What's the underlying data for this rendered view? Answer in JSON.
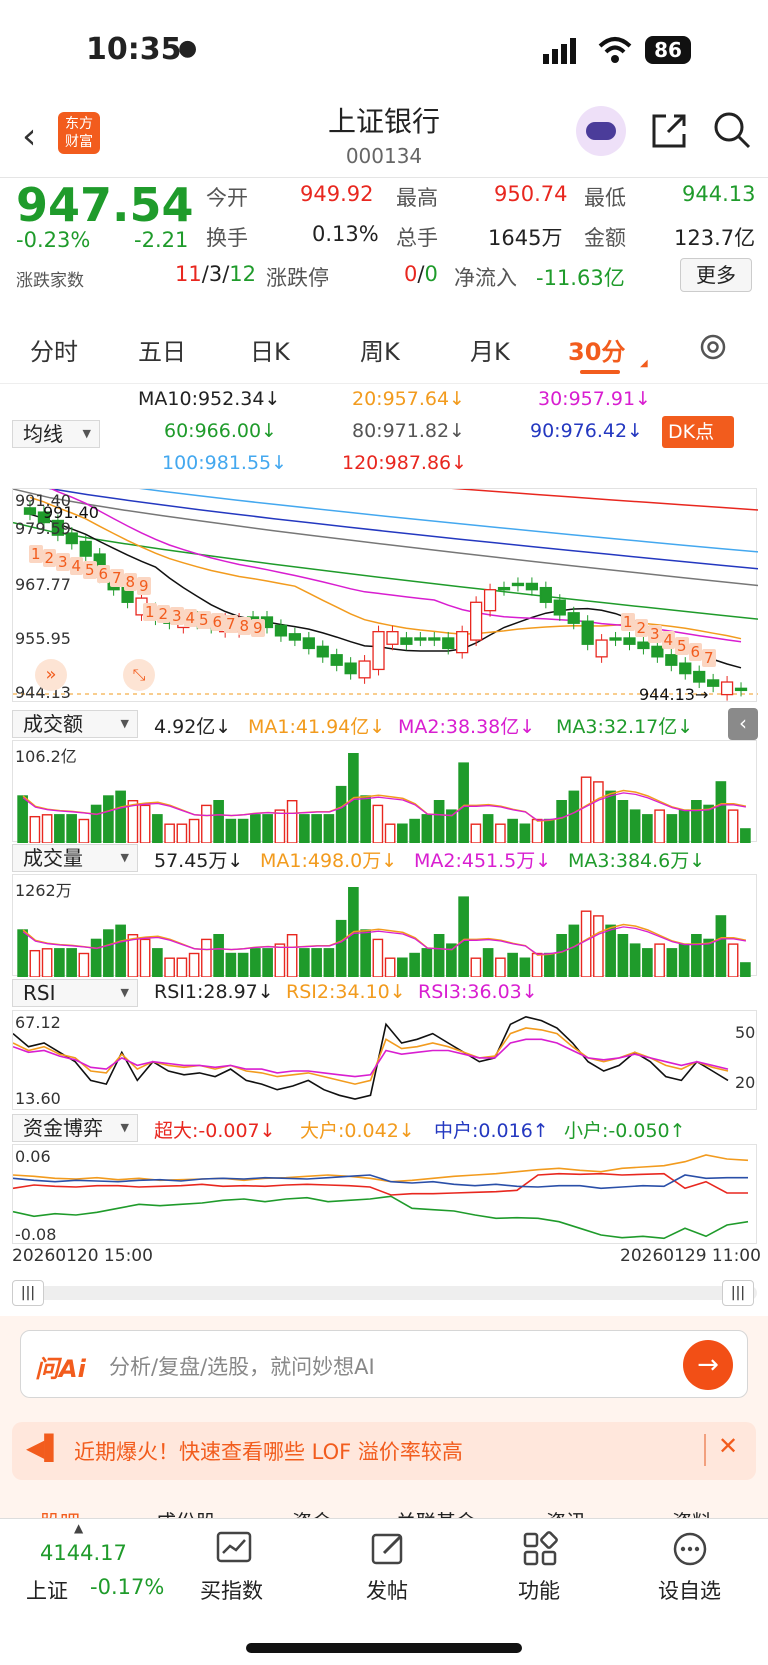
{
  "status": {
    "time": "10:35",
    "battery": "86"
  },
  "header": {
    "title": "上证银行",
    "code": "000134",
    "logo_line1": "东方",
    "logo_line2": "财富"
  },
  "quote": {
    "price": "947.54",
    "pct": "-0.23%",
    "chg": "-2.21",
    "open_label": "今开",
    "open": "949.92",
    "high_label": "最高",
    "high": "950.74",
    "low_label": "最低",
    "low": "944.13",
    "turnover_label": "换手",
    "turnover": "0.13%",
    "vol_label": "总手",
    "vol": "1645万",
    "amount_label": "金额",
    "amount": "123.7亿",
    "breadth_label": "涨跌家数",
    "up": "11",
    "sep1": "/",
    "flat": "3",
    "sep2": "/",
    "down": "12",
    "limit_label": "涨跌停",
    "limit_up": "0",
    "limit_sep": "/",
    "limit_down": "0",
    "flow_label": "净流入",
    "flow": "-11.63亿",
    "more": "更多"
  },
  "tabs": [
    "分时",
    "五日",
    "日K",
    "周K",
    "月K",
    "30分"
  ],
  "ma": {
    "select": "均线",
    "ma10": "MA10:952.34↓",
    "ma20": "20:957.64↓",
    "ma30": "30:957.91↓",
    "ma60": "60:966.00↓",
    "ma80": "80:971.82↓",
    "ma90": "90:976.42↓",
    "ma100": "100:981.55↓",
    "ma120": "120:987.86↓",
    "dk": "DK点"
  },
  "kline": {
    "y_top": "991.40",
    "y_2": "979.59",
    "y_3": "967.77",
    "y_4": "955.95",
    "y_bottom": "944.13",
    "max_label": "991.40",
    "min_label": "944.13→",
    "seq_a": [
      "1",
      "2",
      "3",
      "4",
      "5",
      "6",
      "7",
      "8",
      "9"
    ],
    "seq_b": [
      "1",
      "2",
      "3",
      "4",
      "5",
      "6",
      "7",
      "8",
      "9"
    ],
    "seq_c": [
      "1",
      "2",
      "3",
      "4",
      "5",
      "6",
      "7"
    ],
    "closes": [
      987,
      985,
      982,
      980,
      977,
      972,
      969,
      966,
      964,
      962,
      961,
      962,
      961,
      960,
      961,
      960,
      962,
      960,
      958,
      957,
      955,
      953,
      951,
      949,
      951,
      958,
      957,
      956,
      957,
      957,
      955,
      958,
      965,
      968,
      969,
      970,
      969,
      966,
      963,
      961,
      956,
      954,
      957,
      956,
      955,
      953,
      951,
      949,
      947,
      946,
      945,
      945
    ],
    "up": [
      false,
      false,
      false,
      false,
      false,
      false,
      false,
      false,
      true,
      false,
      false,
      true,
      false,
      false,
      true,
      true,
      false,
      false,
      false,
      false,
      false,
      false,
      false,
      false,
      true,
      true,
      true,
      false,
      false,
      false,
      false,
      true,
      true,
      true,
      false,
      false,
      false,
      false,
      false,
      false,
      false,
      true,
      false,
      false,
      false,
      false,
      false,
      false,
      false,
      false,
      true,
      false
    ]
  },
  "amount": {
    "select": "成交额",
    "value": "4.92亿↓",
    "ma1": "MA1:41.94亿↓",
    "ma2": "MA2:38.38亿↓",
    "ma3": "MA3:32.17亿↓",
    "ymax": "106.2亿",
    "bars": [
      50,
      28,
      30,
      30,
      30,
      25,
      40,
      50,
      55,
      45,
      40,
      30,
      20,
      20,
      25,
      40,
      45,
      25,
      25,
      30,
      30,
      35,
      45,
      30,
      30,
      30,
      60,
      95,
      50,
      40,
      20,
      20,
      25,
      30,
      45,
      35,
      85,
      20,
      30,
      20,
      25,
      20,
      25,
      25,
      45,
      55,
      70,
      65,
      55,
      45,
      35,
      30,
      35,
      30,
      35,
      45,
      40,
      65,
      35,
      15
    ],
    "bar_up": [
      false,
      true,
      true,
      false,
      false,
      true,
      false,
      false,
      false,
      true,
      true,
      false,
      true,
      true,
      true,
      true,
      false,
      false,
      false,
      false,
      false,
      true,
      true,
      false,
      false,
      false,
      false,
      false,
      false,
      true,
      true,
      false,
      false,
      false,
      false,
      false,
      false,
      true,
      false,
      true,
      false,
      false,
      true,
      false,
      false,
      false,
      true,
      true,
      false,
      false,
      false,
      false,
      true,
      false,
      false,
      false,
      false,
      false,
      true,
      false
    ]
  },
  "volume": {
    "select": "成交量",
    "value": "57.45万↓",
    "ma1": "MA1:498.0万↓",
    "ma2": "MA2:451.5万↓",
    "ma3": "MA3:384.6万↓",
    "ymax": "1262万"
  },
  "rsi": {
    "select": "RSI",
    "r1": "RSI1:28.97↓",
    "r2": "RSI2:34.10↓",
    "r3": "RSI3:36.03↓",
    "ymax": "67.12",
    "ymin": "13.60",
    "l50": "50",
    "l20": "20",
    "r1v": [
      55,
      48,
      50,
      45,
      40,
      30,
      28,
      45,
      30,
      40,
      35,
      33,
      34,
      32,
      36,
      30,
      28,
      25,
      27,
      30,
      25,
      22,
      20,
      22,
      60,
      50,
      52,
      55,
      50,
      45,
      40,
      42,
      60,
      64,
      62,
      58,
      50,
      40,
      35,
      38,
      45,
      40,
      32,
      30,
      40,
      35,
      30
    ],
    "r2v": [
      50,
      46,
      48,
      44,
      42,
      35,
      34,
      44,
      36,
      40,
      38,
      37,
      38,
      36,
      38,
      35,
      34,
      32,
      33,
      34,
      32,
      30,
      28,
      30,
      52,
      47,
      48,
      50,
      48,
      45,
      42,
      43,
      55,
      58,
      57,
      55,
      48,
      42,
      40,
      42,
      45,
      42,
      38,
      36,
      40,
      37,
      35
    ],
    "r3v": [
      48,
      45,
      46,
      43,
      41,
      37,
      36,
      42,
      38,
      40,
      39,
      38,
      38,
      37,
      38,
      36,
      36,
      34,
      35,
      35,
      34,
      33,
      32,
      33,
      46,
      44,
      45,
      46,
      46,
      44,
      42,
      42,
      50,
      52,
      52,
      50,
      46,
      42,
      41,
      42,
      44,
      42,
      40,
      38,
      40,
      38,
      36
    ]
  },
  "fund": {
    "select": "资金博弈",
    "super": "超大:-0.007↓",
    "big": "大户:0.042↓",
    "mid": "中户:0.016↑",
    "small": "小户:-0.050↑",
    "ymax": "0.06",
    "ymin": "-0.08",
    "date_left": "20260120 15:00",
    "date_right": "20260129 11:00",
    "super_v": [
      0.0,
      0.005,
      0.003,
      0.002,
      0.004,
      0.004,
      0.002,
      0.003,
      0.004,
      0.006,
      0.003,
      0.004,
      0.003,
      0.005,
      0.006,
      0.005,
      0.004,
      0.002,
      -0.01,
      -0.008,
      -0.008,
      -0.007,
      -0.006,
      -0.005,
      -0.003,
      0.02,
      0.022,
      0.021,
      0.022,
      0.02,
      0.021,
      0.022,
      0.0,
      0.01,
      -0.007,
      -0.007
    ],
    "big_v": [
      0.02,
      0.018,
      0.015,
      0.014,
      0.016,
      0.013,
      0.015,
      0.012,
      0.013,
      0.014,
      0.015,
      0.012,
      0.015,
      0.016,
      0.018,
      0.02,
      0.018,
      0.015,
      0.01,
      0.012,
      0.015,
      0.018,
      0.02,
      0.022,
      0.025,
      0.028,
      0.03,
      0.027,
      0.025,
      0.03,
      0.032,
      0.034,
      0.04,
      0.05,
      0.044,
      0.042
    ],
    "mid_v": [
      0.015,
      0.012,
      0.01,
      0.012,
      0.011,
      0.01,
      0.012,
      0.013,
      0.011,
      0.014,
      0.015,
      0.014,
      0.016,
      0.015,
      0.014,
      0.016,
      0.018,
      0.02,
      0.01,
      0.008,
      0.01,
      0.006,
      0.004,
      0.006,
      0.003,
      0.002,
      0.004,
      0.004,
      0.0,
      0.002,
      0.004,
      0.003,
      0.02,
      0.015,
      0.016,
      0.016
    ],
    "small_v": [
      -0.035,
      -0.042,
      -0.038,
      -0.04,
      -0.036,
      -0.03,
      -0.024,
      -0.026,
      -0.024,
      -0.022,
      -0.018,
      -0.016,
      -0.02,
      -0.016,
      -0.014,
      -0.02,
      -0.018,
      -0.016,
      -0.012,
      -0.03,
      -0.032,
      -0.034,
      -0.04,
      -0.045,
      -0.044,
      -0.045,
      -0.05,
      -0.06,
      -0.07,
      -0.074,
      -0.072,
      -0.075,
      -0.06,
      -0.072,
      -0.055,
      -0.05
    ]
  },
  "ai": {
    "logo": "问Ai",
    "placeholder": "分析/复盘/选股，就问妙想AI"
  },
  "promo": {
    "text": "近期爆火！快速查看哪些 LOF 溢价率较高"
  },
  "subtabs": [
    "股吧",
    "成份股",
    "资金",
    "关联基金",
    "资讯",
    "资料"
  ],
  "bottom": {
    "index_value": "4144.17",
    "index_name": "上证",
    "index_pct": "-0.17%",
    "b1": "买指数",
    "b2": "发帖",
    "b3": "功能",
    "b4": "设自选"
  }
}
